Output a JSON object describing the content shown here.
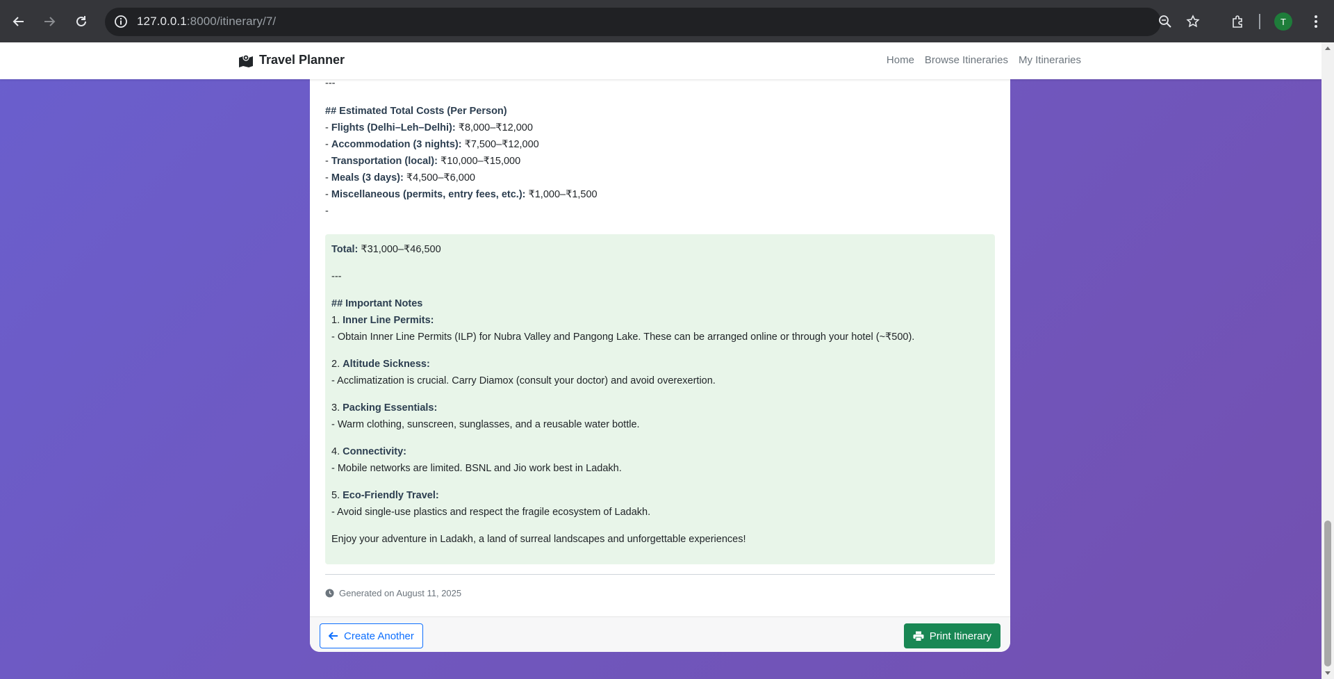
{
  "browser": {
    "url_host": "127.0.0.1",
    "url_path": ":8000/itinerary/7/",
    "avatar_letter": "T"
  },
  "navbar": {
    "brand": "Travel Planner",
    "links": [
      "Home",
      "Browse Itineraries",
      "My Itineraries"
    ]
  },
  "itinerary": {
    "divider_top": "---",
    "costs_heading": "## Estimated Total Costs (Per Person)",
    "costs": [
      {
        "label": "Flights (Delhi–Leh–Delhi):",
        "value": " ₹8,000–₹12,000"
      },
      {
        "label": "Accommodation (3 nights):",
        "value": " ₹7,500–₹12,000"
      },
      {
        "label": "Transportation (local):",
        "value": " ₹10,000–₹15,000"
      },
      {
        "label": "Meals (3 days):",
        "value": " ₹4,500–₹6,000"
      },
      {
        "label": "Miscellaneous (permits, entry fees, etc.):",
        "value": " ₹1,000–₹1,500"
      }
    ],
    "dash": "-",
    "total_label": "Total:",
    "total_value": " ₹31,000–₹46,500",
    "divider_mid": "---",
    "notes_heading": "## Important Notes",
    "notes": [
      {
        "num": "1.",
        "title": "Inner Line Permits:",
        "text": "- Obtain Inner Line Permits (ILP) for Nubra Valley and Pangong Lake. These can be arranged online or through your hotel (~₹500)."
      },
      {
        "num": "2.",
        "title": "Altitude Sickness:",
        "text": "- Acclimatization is crucial. Carry Diamox (consult your doctor) and avoid overexertion."
      },
      {
        "num": "3.",
        "title": "Packing Essentials:",
        "text": "- Warm clothing, sunscreen, sunglasses, and a reusable water bottle."
      },
      {
        "num": "4.",
        "title": "Connectivity:",
        "text": "- Mobile networks are limited. BSNL and Jio work best in Ladakh."
      },
      {
        "num": "5.",
        "title": "Eco-Friendly Travel:",
        "text": "- Avoid single-use plastics and respect the fragile ecosystem of Ladakh."
      }
    ],
    "closing": "Enjoy your adventure in Ladakh, a land of surreal landscapes and unforgettable experiences!",
    "generated": "Generated on August 11, 2025"
  },
  "footer": {
    "create_another": "Create Another",
    "print": "Print Itinerary"
  },
  "colors": {
    "accent": "#0d6efd",
    "success": "#198754",
    "notes_bg": "#e8f5e9",
    "gradient_start": "#6a5fcd",
    "gradient_end": "#7350b0"
  }
}
